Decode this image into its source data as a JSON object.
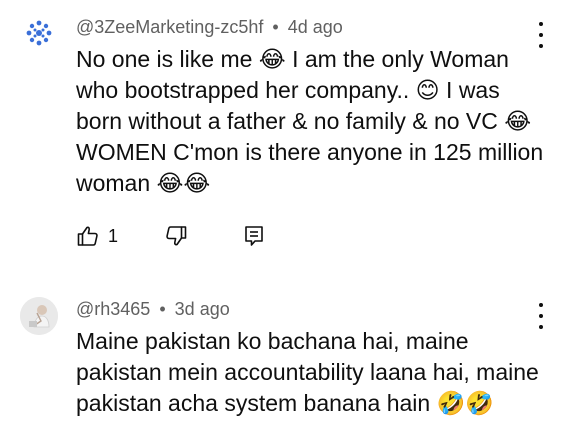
{
  "comments": [
    {
      "author": "@3ZeeMarketing-zc5hf",
      "separator": "•",
      "time": "4d ago",
      "text": "No one is like me 😂 I am the only Woman who bootstrapped her company.. 😊 I was born without a father & no family & no VC 😂 WOMEN C'mon is there anyone in 125 million woman 😂😂",
      "likes": "1",
      "avatar_icon": "blue-dots-logo-icon"
    },
    {
      "author": "@rh3465",
      "separator": "•",
      "time": "3d ago",
      "text": "Maine pakistan ko bachana hai, maine pakistan mein accountability laana hai, maine pakistan acha system banana hain 🤣🤣",
      "avatar_icon": "person-photo-avatar-icon"
    }
  ],
  "icons": {
    "like": "thumbs-up-icon",
    "dislike": "thumbs-down-icon",
    "reply": "reply-comment-icon",
    "more": "more-vertical-icon"
  },
  "colors": {
    "text": "#0f0f0f",
    "meta": "#606060",
    "logo_blue": "#3a6fd8"
  }
}
